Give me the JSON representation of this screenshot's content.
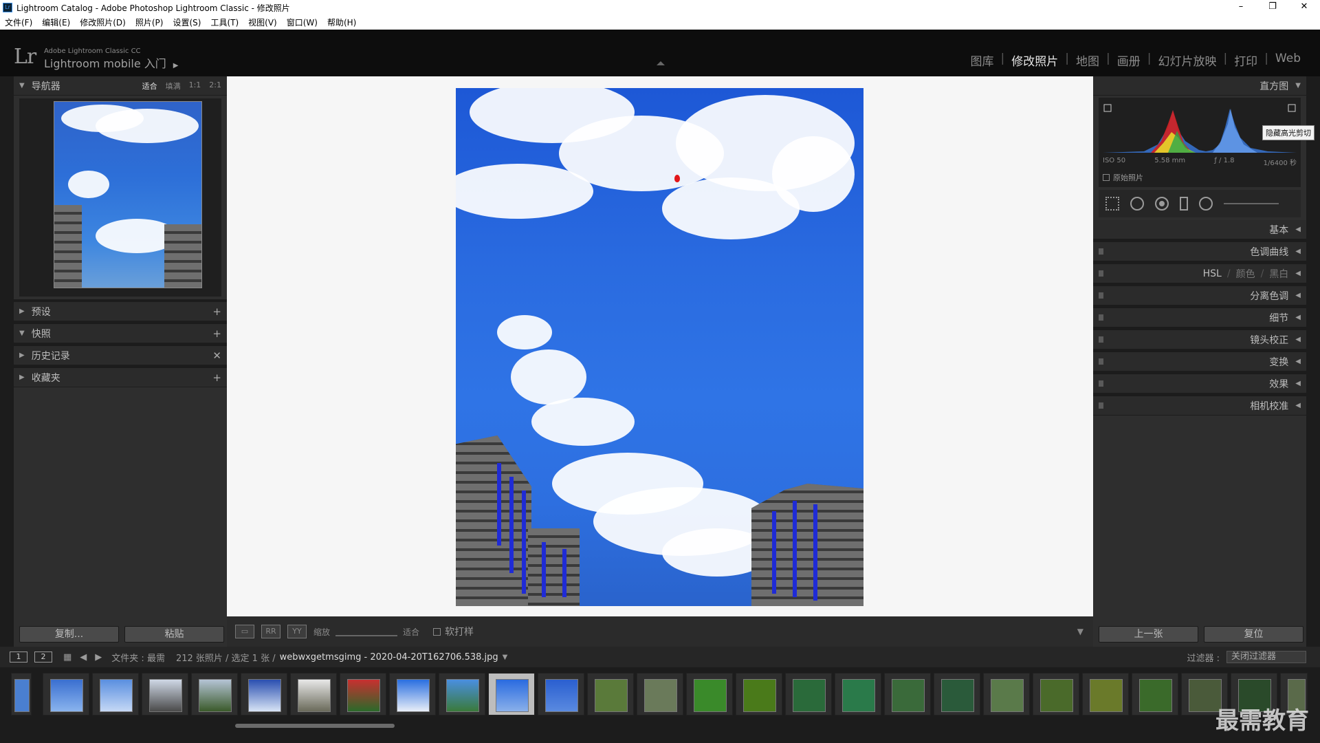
{
  "window": {
    "title": "Lightroom Catalog - Adobe Photoshop Lightroom Classic - 修改照片",
    "controls": [
      "–",
      "❐",
      "✕"
    ]
  },
  "menu": [
    "文件(F)",
    "编辑(E)",
    "修改照片(D)",
    "照片(P)",
    "设置(S)",
    "工具(T)",
    "视图(V)",
    "窗口(W)",
    "帮助(H)"
  ],
  "brand": {
    "logo": "Lr",
    "product": "Adobe Lightroom Classic CC",
    "mobile": "Lightroom mobile 入门",
    "arrow": "▶"
  },
  "modules": [
    "图库",
    "修改照片",
    "地图",
    "画册",
    "幻灯片放映",
    "打印",
    "Web"
  ],
  "module_active": "修改照片",
  "left_panel": {
    "navigator": {
      "title": "导航器",
      "options": [
        "适合",
        "填满",
        "1:1",
        "2:1"
      ],
      "selected": "适合"
    },
    "sections": [
      {
        "title": "预设",
        "action": "+"
      },
      {
        "title": "快照",
        "action": "+"
      },
      {
        "title": "历史记录",
        "action": "✕"
      },
      {
        "title": "收藏夹",
        "action": "+"
      }
    ],
    "copy_btn": "复制...",
    "paste_btn": "粘贴"
  },
  "toolbar": {
    "zoom_label": "缩放",
    "zoom_value": "适合",
    "proof_label": "软打样"
  },
  "right_panel": {
    "histogram_title": "直方图",
    "iso": "ISO 50",
    "focal": "5.58 mm",
    "aperture": "ƒ / 1.8",
    "shutter": "1/6400 秒",
    "original_photo": "原始照片",
    "tooltip": "隐藏高光剪切",
    "panels": [
      "基本",
      "色调曲线",
      "HSL",
      "颜色",
      "黑白",
      "分离色调",
      "细节",
      "镜头校正",
      "变换",
      "效果",
      "相机校准"
    ],
    "prev_btn": "上一张",
    "reset_btn": "复位"
  },
  "filmstrip_bar": {
    "screen1": "1",
    "screen2": "2",
    "folder_label": "文件夹 : 最需",
    "count": "212 张照片 / 选定 1 张 /",
    "filename": "webwxgetmsgimg - 2020-04-20T162706.538.jpg",
    "filter_label": "过滤器 :",
    "filter_value": "关闭过滤器"
  },
  "watermark": "最需教育",
  "colors": {
    "accent_red": "#e2161a",
    "sky_blue": "#2a6be0",
    "bg_dark": "#1c1c1c",
    "panel": "#2e2e2e"
  }
}
